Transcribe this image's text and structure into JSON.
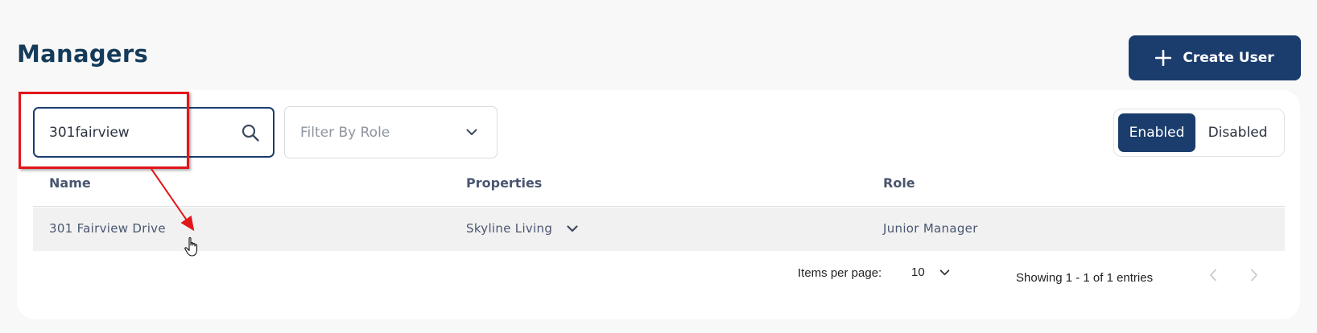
{
  "page": {
    "title": "Managers"
  },
  "toolbar": {
    "create_label": "Create User"
  },
  "search": {
    "value": "301fairview"
  },
  "role_filter": {
    "placeholder": "Filter By Role"
  },
  "status_toggle": {
    "enabled_label": "Enabled",
    "disabled_label": "Disabled",
    "active": "Enabled"
  },
  "table": {
    "columns": [
      "Name",
      "Properties",
      "Role"
    ],
    "rows": [
      {
        "name": "301 Fairview Drive",
        "properties": "Skyline Living",
        "role": "Junior Manager"
      }
    ]
  },
  "pagination": {
    "items_per_page_label": "Items per page:",
    "items_per_page": "10",
    "showing": "Showing 1 - 1 of 1 entries"
  },
  "colors": {
    "primary": "#1b3d6d",
    "title": "#143c5a",
    "annotation": "#e3161b"
  }
}
